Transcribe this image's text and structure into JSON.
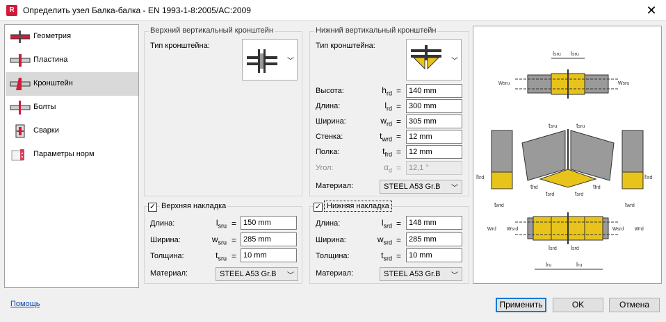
{
  "window": {
    "app_icon_letter": "R",
    "title": "Определить узел Балка-балка - EN 1993-1-8:2005/AC:2009"
  },
  "sidebar": {
    "items": [
      {
        "label": "Геометрия",
        "icon": "geometry-icon"
      },
      {
        "label": "Пластина",
        "icon": "plate-icon"
      },
      {
        "label": "Кронштейн",
        "icon": "bracket-icon",
        "selected": true
      },
      {
        "label": "Болты",
        "icon": "bolts-icon"
      },
      {
        "label": "Сварки",
        "icon": "welds-icon"
      },
      {
        "label": "Параметры норм",
        "icon": "code-params-icon"
      }
    ]
  },
  "upper_bracket": {
    "title": "Верхний вертикальный кронштейн",
    "type_label": "Тип кронштейна:"
  },
  "lower_bracket": {
    "title": "Нижний вертикальный кронштейн",
    "type_label": "Тип кронштейна:",
    "rows": [
      {
        "label": "Высота:",
        "sym": "h",
        "sub": "rd",
        "value": "140 mm"
      },
      {
        "label": "Длина:",
        "sym": "l",
        "sub": "rd",
        "value": "300 mm"
      },
      {
        "label": "Ширина:",
        "sym": "w",
        "sub": "rd",
        "value": "305 mm"
      },
      {
        "label": "Стенка:",
        "sym": "t",
        "sub": "wrd",
        "value": "12 mm"
      },
      {
        "label": "Полка:",
        "sym": "t",
        "sub": "frd",
        "value": "12 mm"
      },
      {
        "label": "Угол:",
        "sym": "α",
        "sub": "d",
        "value": "12,1 °"
      }
    ],
    "material_label": "Материал:",
    "material_value": "STEEL A53 Gr.B"
  },
  "upper_plate": {
    "checked": true,
    "title": "Верхняя накладка",
    "rows": [
      {
        "label": "Длина:",
        "sym": "l",
        "sub": "sru",
        "value": "150 mm"
      },
      {
        "label": "Ширина:",
        "sym": "w",
        "sub": "sru",
        "value": "285 mm"
      },
      {
        "label": "Толщина:",
        "sym": "t",
        "sub": "sru",
        "value": "10 mm"
      }
    ],
    "material_label": "Материал:",
    "material_value": "STEEL A53 Gr.B"
  },
  "lower_plate": {
    "checked": true,
    "title": "Нижняя накладка",
    "rows": [
      {
        "label": "Длина:",
        "sym": "l",
        "sub": "srd",
        "value": "148 mm"
      },
      {
        "label": "Ширина:",
        "sym": "w",
        "sub": "srd",
        "value": "285 mm"
      },
      {
        "label": "Толщина:",
        "sym": "t",
        "sub": "srd",
        "value": "10 mm"
      }
    ],
    "material_label": "Материал:",
    "material_value": "STEEL A53 Gr.B"
  },
  "preview": {
    "dim_labels": [
      "l",
      "sru",
      "l",
      "sru",
      "w",
      "sru",
      "w",
      "sru",
      "t",
      "sru",
      "t",
      "sru",
      "h",
      "rd",
      "h",
      "rd",
      "t",
      "frd",
      "t",
      "frd",
      "t",
      "srd",
      "t",
      "srd",
      "t",
      "wrd",
      "t",
      "wrd",
      "w",
      "rd",
      "w",
      "srd",
      "w",
      "srd",
      "w",
      "rd",
      "l",
      "srd",
      "l",
      "srd",
      "l",
      "ru",
      "l",
      "ru"
    ]
  },
  "footer": {
    "help": "Помощь",
    "apply": "Применить",
    "ok": "OK",
    "cancel": "Отмена"
  },
  "colors": {
    "accent": "#0078d7",
    "steel_yellow": "#e8c31a",
    "beam_grey": "#8a8a8a",
    "link": "#0645ad"
  }
}
